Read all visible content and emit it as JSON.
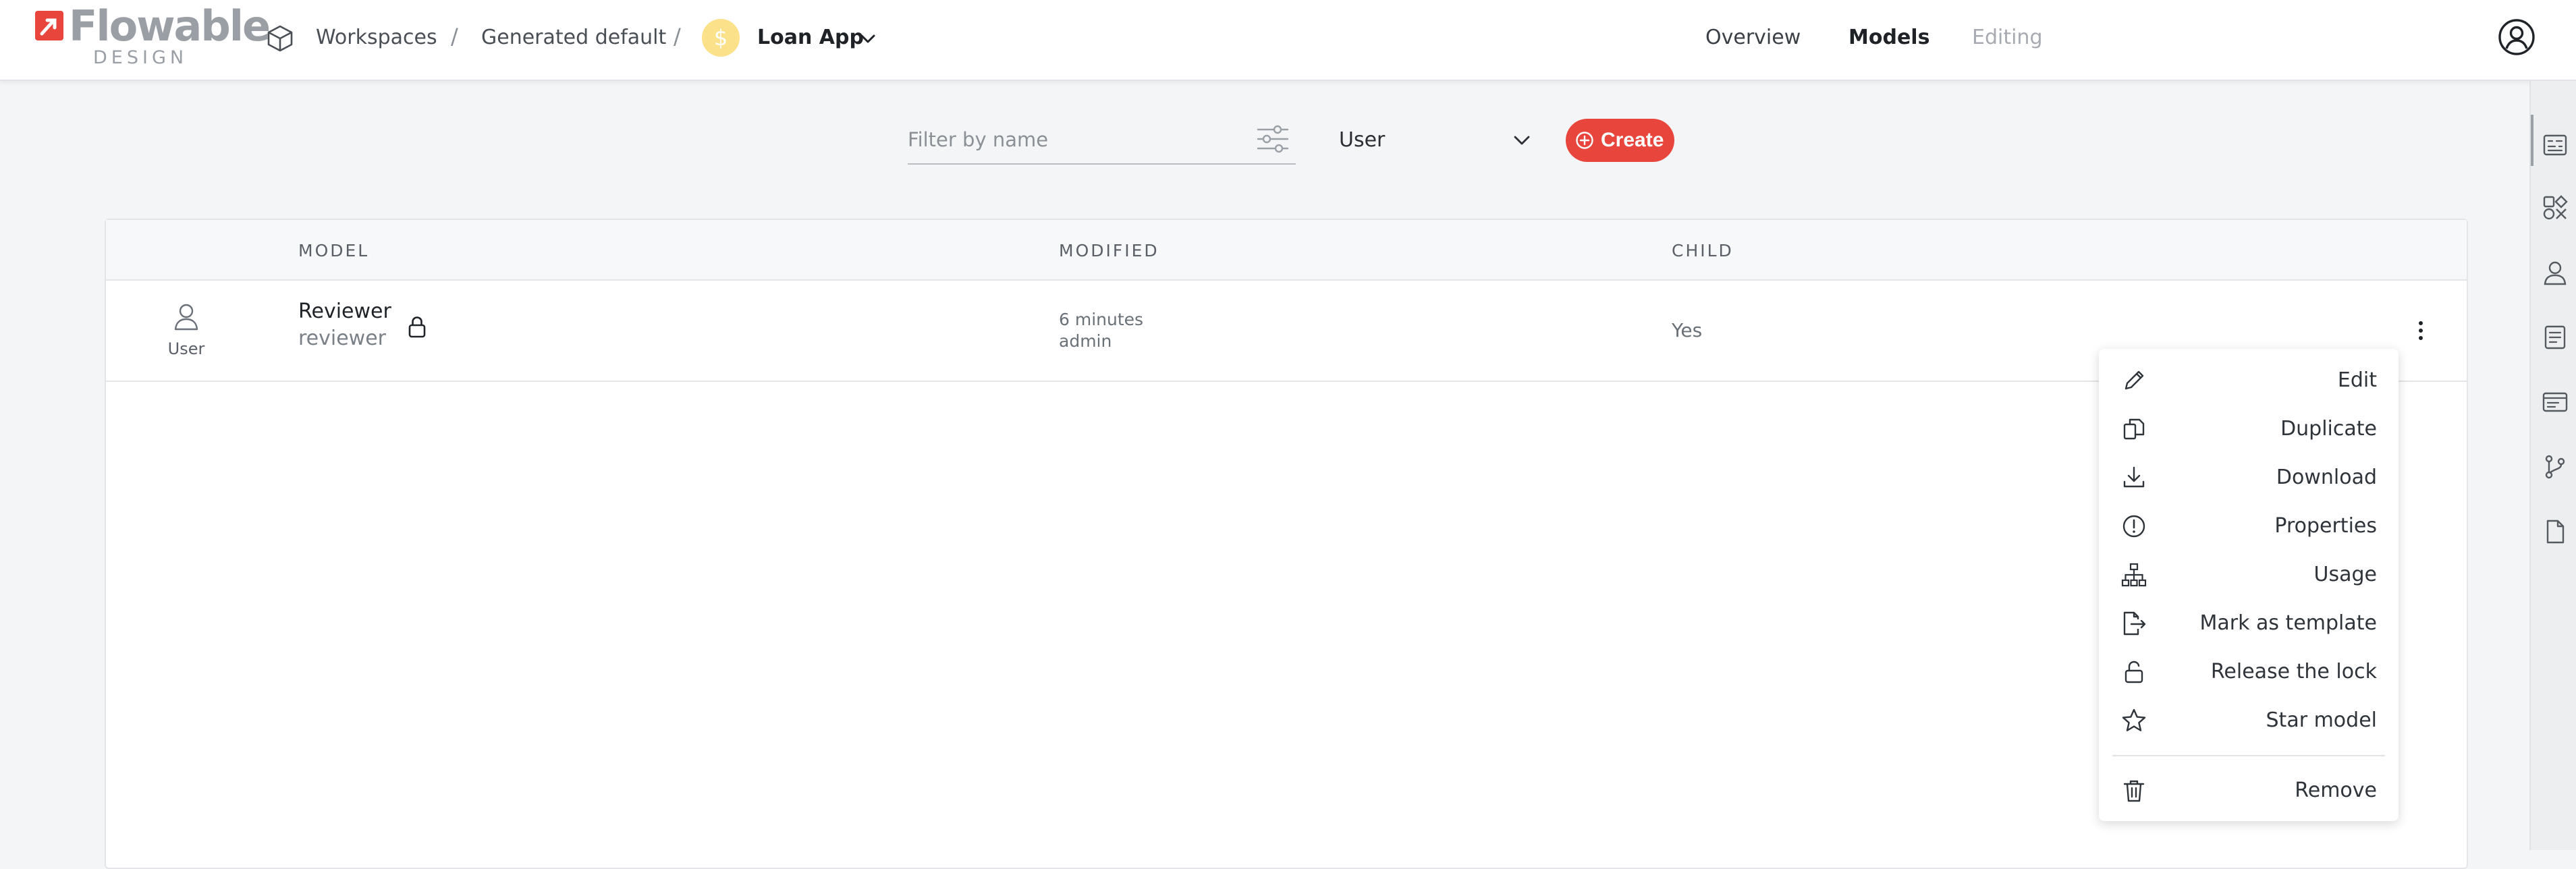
{
  "brand": {
    "logo_text": "Flowable",
    "logo_sub": "DESIGN",
    "accent": "#e8463c"
  },
  "breadcrumb": {
    "workspaces": "Workspaces",
    "workspace": "Generated default",
    "separator": "/",
    "app_badge": "$",
    "app_name": "Loan App"
  },
  "nav": {
    "overview": "Overview",
    "models": "Models",
    "editing": "Editing"
  },
  "filter": {
    "placeholder": "Filter by name",
    "value": ""
  },
  "type_select": {
    "value": "User"
  },
  "create_button": {
    "label": "Create"
  },
  "table": {
    "headers": {
      "model": "MODEL",
      "modified": "MODIFIED",
      "child": "CHILD"
    },
    "rows": [
      {
        "type_label": "User",
        "name": "Reviewer",
        "key": "reviewer",
        "modified_when": "6 minutes",
        "modified_by": "admin",
        "child": "Yes"
      }
    ]
  },
  "context_menu": {
    "items": [
      {
        "label": "Edit",
        "icon": "pencil-icon"
      },
      {
        "label": "Duplicate",
        "icon": "copy-icon"
      },
      {
        "label": "Download",
        "icon": "download-icon"
      },
      {
        "label": "Properties",
        "icon": "info-circle-icon"
      },
      {
        "label": "Usage",
        "icon": "hierarchy-icon"
      },
      {
        "label": "Mark as template",
        "icon": "file-export-icon"
      },
      {
        "label": "Release the lock",
        "icon": "unlock-icon"
      },
      {
        "label": "Star model",
        "icon": "star-icon"
      },
      {
        "label": "Remove",
        "icon": "trash-icon"
      }
    ]
  },
  "right_sidebar": {
    "icons": [
      "properties-panel-icon",
      "shapes-icon",
      "user-icon",
      "document-icon",
      "form-icon",
      "branch-icon",
      "file-icon"
    ]
  }
}
